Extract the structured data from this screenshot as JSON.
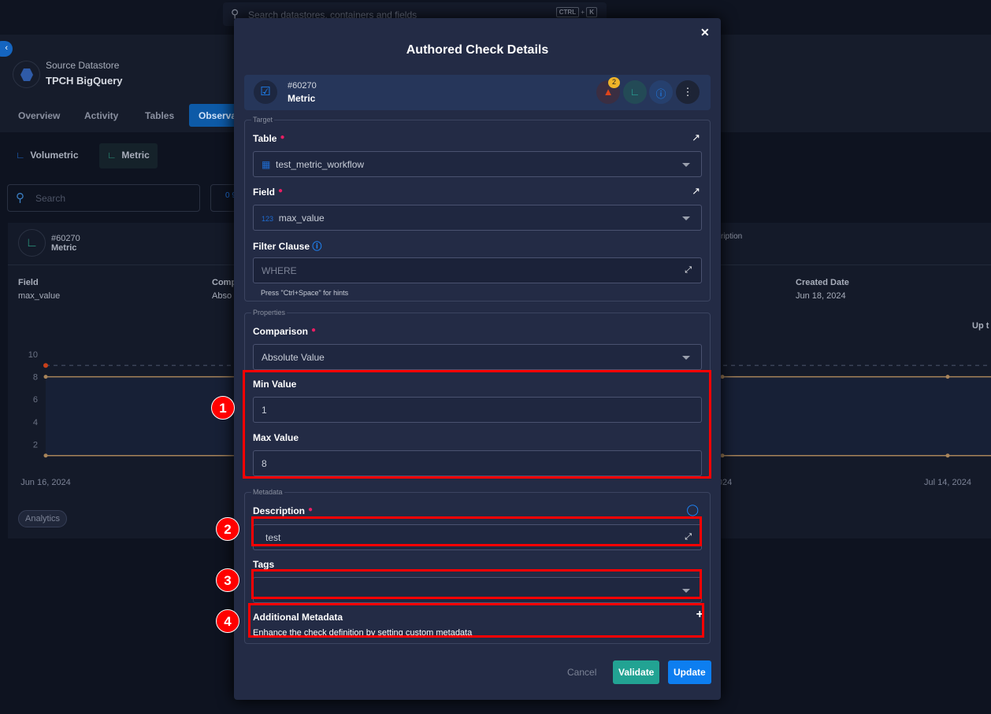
{
  "global_search": {
    "placeholder": "Search datastores, containers and fields",
    "shortcut": [
      "CTRL",
      "+",
      "K"
    ]
  },
  "datastore": {
    "type": "Source Datastore",
    "name": "TPCH BigQuery"
  },
  "tabs": [
    {
      "label": "Overview"
    },
    {
      "label": "Activity"
    },
    {
      "label": "Tables"
    },
    {
      "label": "Observability",
      "active": true
    }
  ],
  "subtabs": [
    {
      "label": "Volumetric"
    },
    {
      "label": "Metric",
      "active": true
    }
  ],
  "list_search": {
    "placeholder": "Search"
  },
  "bg_card": {
    "id": "#60270",
    "type": "Metric",
    "field_label": "Field",
    "field_value": "max_value",
    "comparison_label": "Comp",
    "comparison_value": "Abso",
    "description_label": "ription",
    "created_label": "Created Date",
    "created_value": "Jun 18, 2024",
    "extra": "Up t",
    "tag": "Analytics"
  },
  "chart_data": {
    "type": "line",
    "y_ticks": [
      "10",
      "8",
      "6",
      "4",
      "2"
    ],
    "ylim": [
      0,
      10
    ],
    "x_labels": [
      "Jun 16, 2024",
      "2024",
      "Jul 14, 2024"
    ],
    "series": [
      {
        "values": [
          8,
          8,
          8
        ]
      },
      {
        "values": [
          1,
          1,
          1
        ]
      }
    ],
    "anomaly": 9,
    "line_color": "#a8845a",
    "anomaly_color": "#c8401a"
  },
  "modal": {
    "title": "Authored Check Details",
    "check": {
      "id": "#60270",
      "type": "Metric",
      "anomaly_count": "2"
    },
    "target": {
      "legend": "Target",
      "table_label": "Table",
      "table_value": "test_metric_workflow",
      "field_label": "Field",
      "field_type": "123",
      "field_value": "max_value",
      "filter_label": "Filter Clause",
      "filter_placeholder": "WHERE",
      "filter_hint": "Press \"Ctrl+Space\" for hints"
    },
    "properties": {
      "legend": "Properties",
      "comparison_label": "Comparison",
      "comparison_value": "Absolute Value",
      "min_label": "Min Value",
      "min_value": "1",
      "max_label": "Max Value",
      "max_value": "8"
    },
    "metadata": {
      "legend": "Metadata",
      "description_label": "Description",
      "description_value": "test",
      "tags_label": "Tags",
      "additional_title": "Additional Metadata",
      "additional_desc": "Enhance the check definition by setting custom metadata"
    },
    "buttons": {
      "cancel": "Cancel",
      "validate": "Validate",
      "update": "Update"
    }
  },
  "annotations": [
    "1",
    "2",
    "3",
    "4"
  ],
  "colors": {
    "accent": "#0d7ef0",
    "validate": "#22a393",
    "annotation": "#ff0000"
  }
}
